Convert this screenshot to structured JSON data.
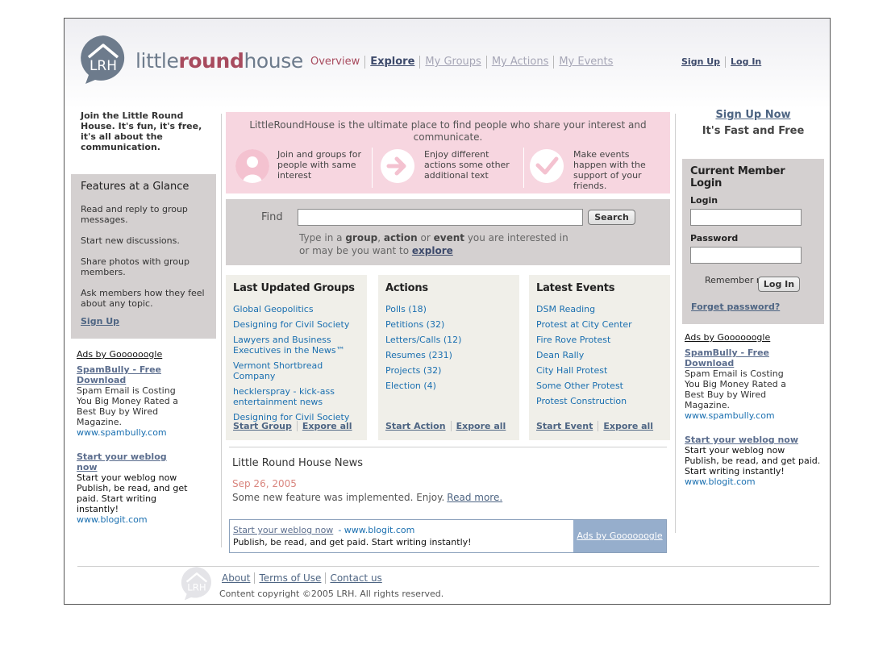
{
  "brand": {
    "name_part1": "little",
    "name_part2": "round",
    "name_part3": "house",
    "mark": "LRH"
  },
  "nav": {
    "items": [
      {
        "label": "Overview",
        "state": "active"
      },
      {
        "label": "Explore",
        "state": "current"
      },
      {
        "label": "My Groups",
        "state": "disabled"
      },
      {
        "label": "My Actions",
        "state": "disabled"
      },
      {
        "label": "My Events",
        "state": "disabled"
      }
    ],
    "signup": "Sign Up",
    "login": "Log In"
  },
  "left": {
    "join_text": "Join the Little Round House. It's fun, it's free, it's all about the communication.",
    "features_title": "Features at a Glance",
    "features": [
      "Read and reply to group messages.",
      "Start new discussions.",
      "Share photos with group members.",
      "Ask members how they feel about any topic."
    ],
    "features_signup": "Sign Up"
  },
  "ads_left": {
    "header": "Ads by Goooooogle",
    "ad1_title": "SpamBully - Free Download",
    "ad1_text": "Spam Email is Costing You Big Money Rated a Best Buy by Wired Magazine.",
    "ad1_url": "www.spambully.com",
    "ad2_title": "Start your weblog now",
    "ad2_text": "Start your weblog now Publish, be read, and get paid. Start writing instantly!",
    "ad2_url": "www.blogit.com"
  },
  "intro": {
    "title": "LittleRoundHouse is the ultimate place to find people who share your interest and communicate.",
    "features": [
      {
        "text": "Join and groups for people with same interest",
        "icon": "person-icon"
      },
      {
        "text": "Enjoy different actions some other additional text",
        "icon": "arrow-right-icon"
      },
      {
        "text": "Make events happen with the support of your friends.",
        "icon": "checkmark-icon"
      }
    ]
  },
  "find": {
    "label": "Find",
    "input_value": "",
    "button": "Search",
    "hint_1": "Type in a ",
    "hint_group": "group",
    "hint_2": ", ",
    "hint_action": "action",
    "hint_3": " or ",
    "hint_event": "event",
    "hint_4": " you are interested in",
    "hint_5": "or may be you want to ",
    "hint_explore": "explore"
  },
  "groups_box": {
    "title": "Last Updated Groups",
    "items": [
      "Global Geopolitics",
      "Designing for Civil Society",
      "Lawyers and Business Executives in the News™",
      "Vermont Shortbread Company",
      "hecklerspray - kick-ass entertainment news",
      "Designing for Civil Society"
    ],
    "start": "Start Group",
    "explore": "Expore all"
  },
  "actions_box": {
    "title": "Actions",
    "items": [
      "Polls (18)",
      "Petitions (32)",
      "Letters/Calls (12)",
      "Resumes (231)",
      "Projects (32)",
      "Election (4)"
    ],
    "start": "Start Action",
    "explore": "Expore all"
  },
  "events_box": {
    "title": "Latest Events",
    "items": [
      "DSM Reading",
      "Protest at City Center",
      "Fire Rove Protest",
      "Dean Rally",
      "City Hall Protest",
      "Some Other Protest",
      "Protest Construction"
    ],
    "start": "Start Event",
    "explore": "Expore all"
  },
  "news": {
    "title": "Little Round House News",
    "date": "Sep 26, 2005",
    "text": "Some new feature was implemented. Enjoy.",
    "more": "Read more."
  },
  "adbar": {
    "title": "Start your weblog now",
    "url": "- www.blogit.com",
    "text": "Publish, be read, and get paid. Start writing instantly!",
    "side": "Ads by Goooooogle"
  },
  "right": {
    "signup_now": "Sign Up Now",
    "fast_free": "It's Fast and Free",
    "login_title": "Current Member Login",
    "login_label": "Login",
    "login_value": "",
    "password_label": "Password",
    "password_value": "",
    "remember": "Remember my ID",
    "login_button": "Log In",
    "forgot": "Forget password?"
  },
  "ads_right": {
    "header": "Ads by Goooooogle",
    "ad1_title": "SpamBully - Free Download",
    "ad1_text": "Spam Email is Costing You Big Money Rated a Best Buy by Wired Magazine.",
    "ad1_url": "www.spambully.com",
    "ad2_title": "Start your weblog now",
    "ad2_text": "Start your weblog now Publish, be read, and get paid. Start writing instantly!",
    "ad2_url": "www.blogit.com"
  },
  "footer": {
    "links": [
      "About",
      "Terms of Use",
      "Contact us"
    ],
    "copyright": "Content copyright ©2005 LRH. All rights reserved."
  },
  "colors": {
    "accent": "#a84b5e",
    "link": "#1a6fb0",
    "panel": "#d4d0d0",
    "intro_bg": "#f7d6e0",
    "box_bg": "#f0efe9"
  }
}
